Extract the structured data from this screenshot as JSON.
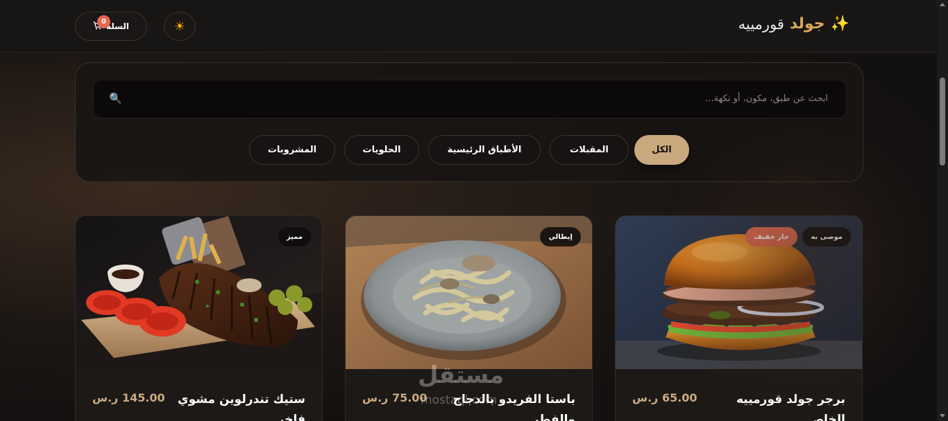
{
  "header": {
    "brand_icon": "sparkles-icon",
    "brand_gold": "جولد",
    "brand_rest": "قورمييه",
    "theme_icon": "sun-icon",
    "cart_label": "السلة",
    "cart_icon": "cart-icon",
    "cart_count": "0"
  },
  "search": {
    "placeholder": "ابحث عن طبق، مكون، أو نكهة...",
    "icon": "search-icon"
  },
  "categories": [
    {
      "label": "الكل",
      "active": true
    },
    {
      "label": "المقبلات",
      "active": false
    },
    {
      "label": "الأطباق الرئيسية",
      "active": false
    },
    {
      "label": "الحلويات",
      "active": false
    },
    {
      "label": "المشروبات",
      "active": false
    }
  ],
  "products": [
    {
      "name": "برجر جولد قورمييه الخاص",
      "price": "65.00 ر.س",
      "badges": [
        "موصى به",
        "حار خفيف"
      ]
    },
    {
      "name": "باستا الفريدو بالدجاج والفطر",
      "price": "75.00 ر.س",
      "badges": [
        "إيطالي"
      ]
    },
    {
      "name": "ستيك تندرلوين مشوي فاخر",
      "price": "145.00 ر.س",
      "badges": [
        "مميز"
      ]
    }
  ],
  "watermark": {
    "main": "مستقل",
    "sub": "mostaql.com"
  },
  "colors": {
    "accent": "#cba97f",
    "brand_gold": "#d9a65a",
    "badge_red": "#dd6a52",
    "cart_badge": "#e8674f"
  }
}
